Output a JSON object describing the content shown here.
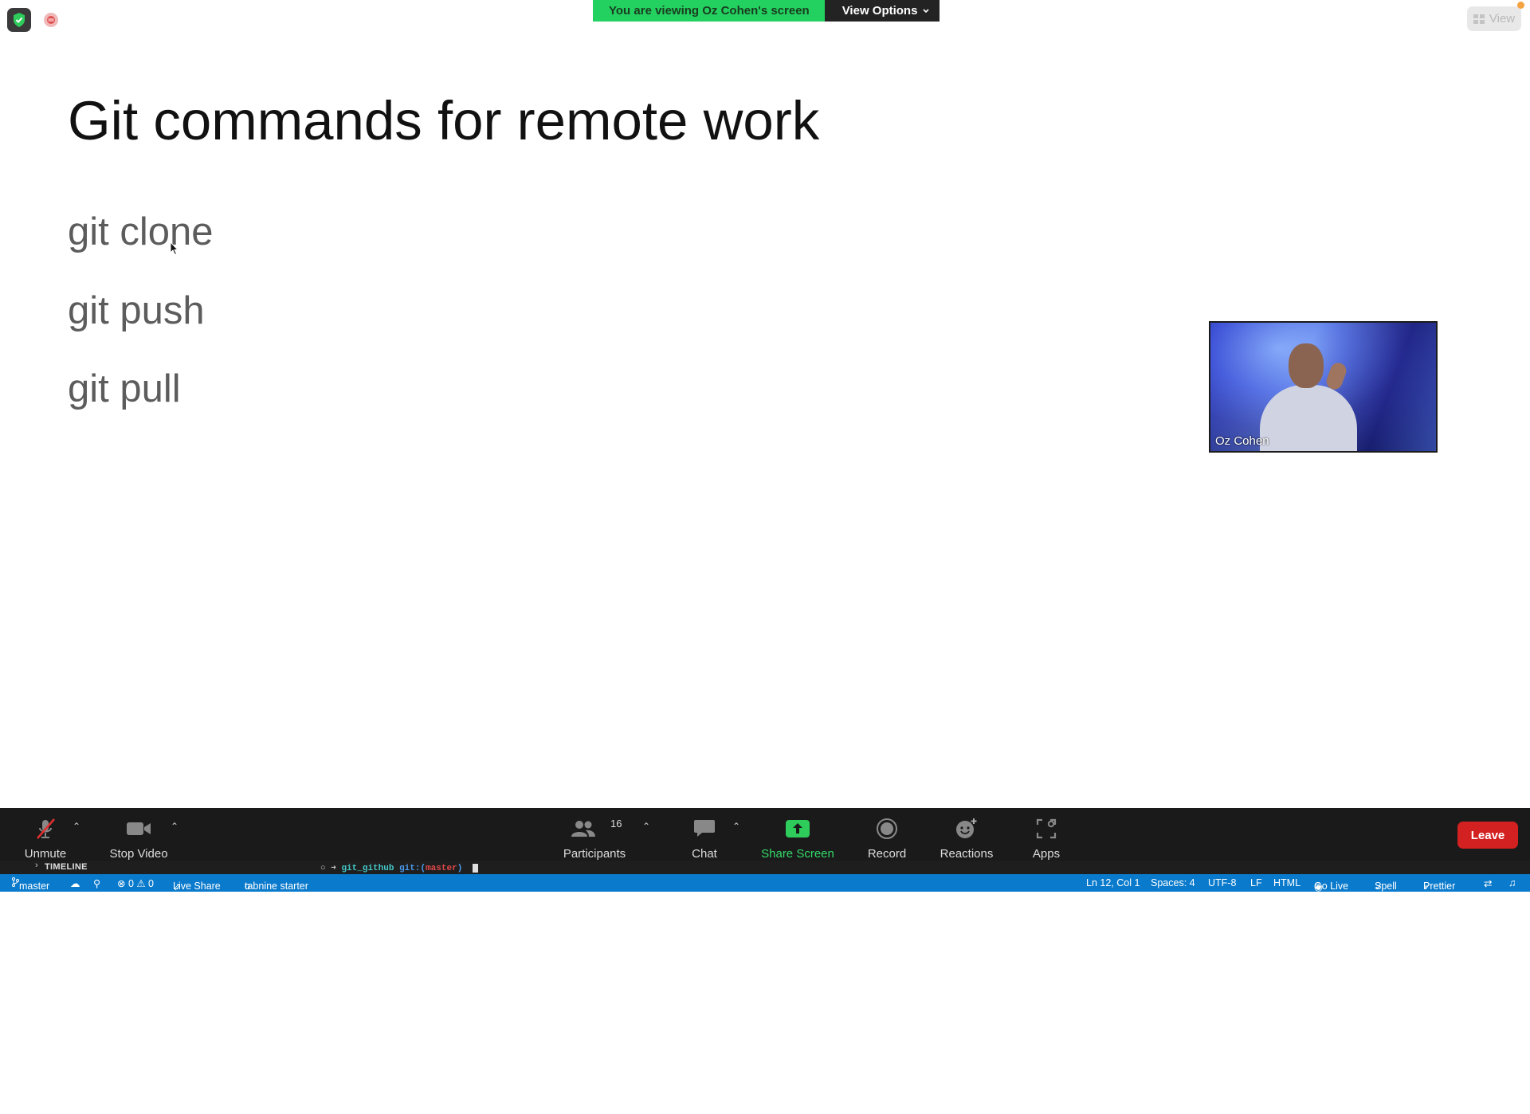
{
  "top_bar": {
    "banner_text": "You are viewing Oz Cohen's screen",
    "view_options_label": "View Options",
    "view_label": "View"
  },
  "slide": {
    "title": "Git commands for remote work",
    "commands": [
      "git clone",
      "git push",
      "git pull"
    ]
  },
  "video": {
    "participant_name": "Oz Cohen"
  },
  "toolbar": {
    "unmute_label": "Unmute",
    "stop_video_label": "Stop Video",
    "participants_label": "Participants",
    "participants_count": "16",
    "chat_label": "Chat",
    "share_screen_label": "Share Screen",
    "record_label": "Record",
    "reactions_label": "Reactions",
    "apps_label": "Apps",
    "leave_label": "Leave"
  },
  "editor": {
    "timeline_label": "TIMELINE",
    "terminal": {
      "arrow": "○ ➜",
      "dir": "git_github",
      "git_prefix": "git:(",
      "branch": "master",
      "git_suffix": ")"
    }
  },
  "status_bar": {
    "branch": "master",
    "problems": "⊗ 0 ⚠ 0",
    "live_share": "Live Share",
    "tabnine": "tabnine starter",
    "position": "Ln 12, Col 1",
    "spaces": "Spaces: 4",
    "encoding": "UTF-8",
    "eol": "LF",
    "language": "HTML",
    "go_live": "Go Live",
    "spell": "Spell",
    "prettier": "Prettier"
  },
  "colors": {
    "banner_green": "#23d160",
    "leave_red": "#d32020",
    "status_blue": "#0a7acc",
    "share_green": "#34d96a"
  }
}
